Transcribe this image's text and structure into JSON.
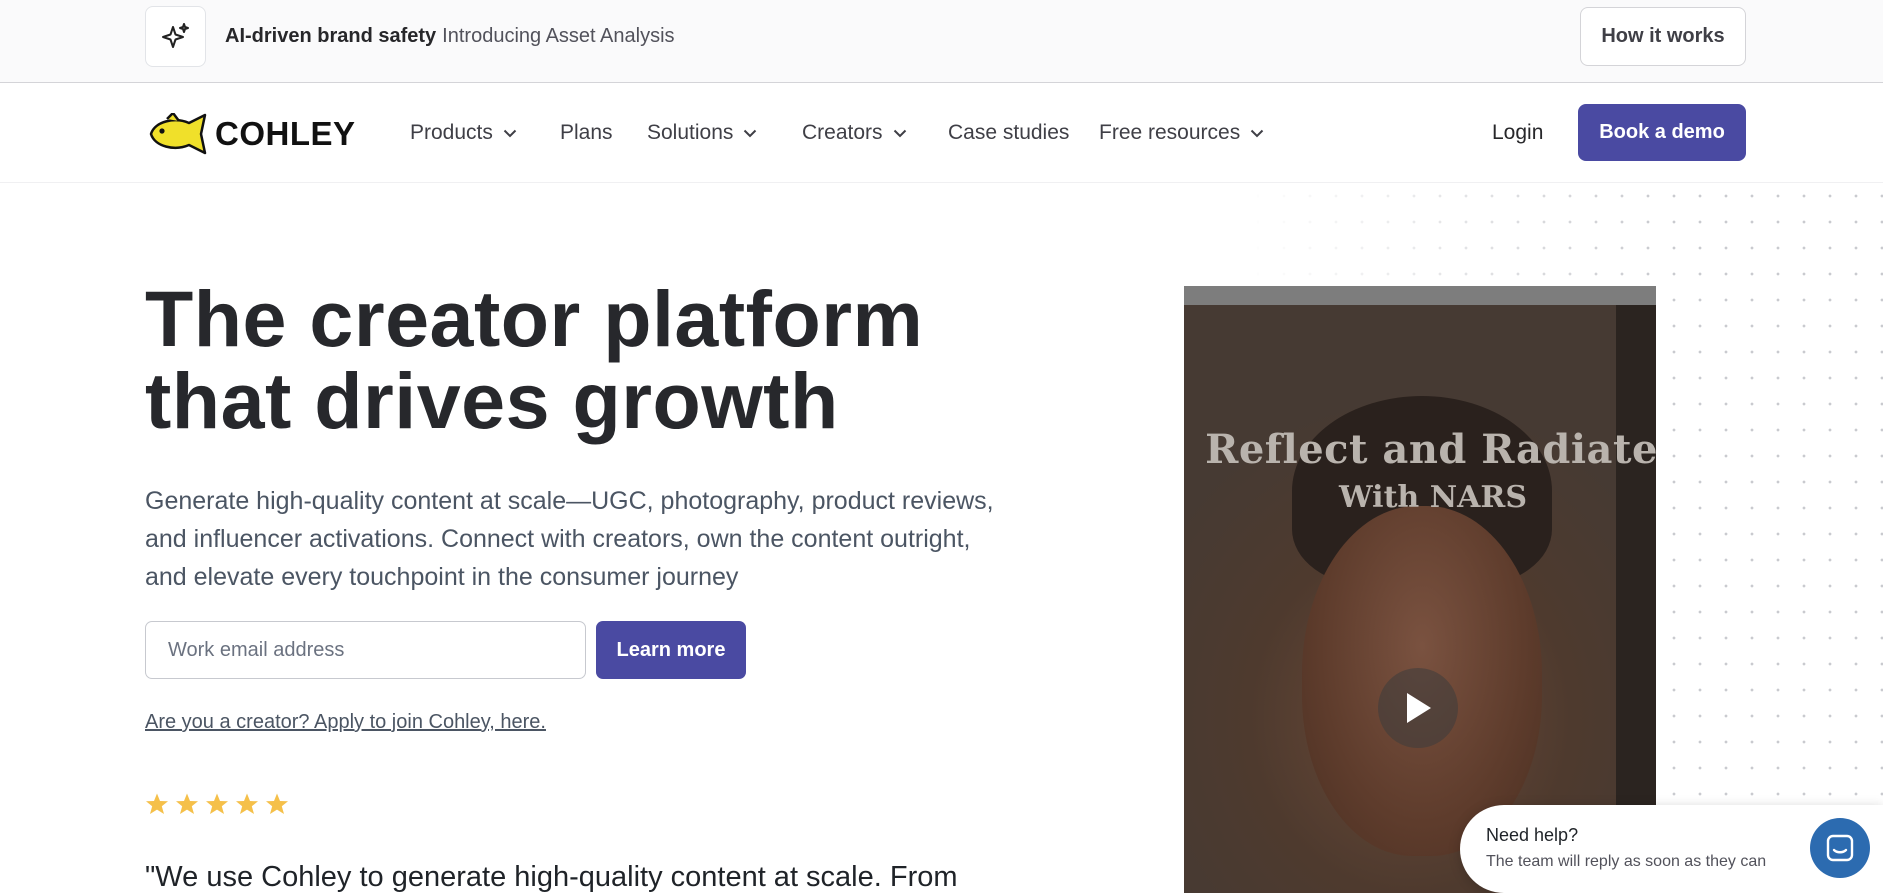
{
  "announcement": {
    "bold_text": "AI-driven brand safety",
    "text": "Introducing Asset Analysis",
    "button_label": "How it works",
    "icon": "sparkles-icon"
  },
  "nav": {
    "logo_text": "COHLEY",
    "items": [
      {
        "label": "Products",
        "dropdown": true
      },
      {
        "label": "Plans",
        "dropdown": false
      },
      {
        "label": "Solutions",
        "dropdown": true
      },
      {
        "label": "Creators",
        "dropdown": true
      },
      {
        "label": "Case studies",
        "dropdown": false
      },
      {
        "label": "Free resources",
        "dropdown": true
      }
    ],
    "login_label": "Login",
    "demo_label": "Book a demo"
  },
  "hero": {
    "headline": "The creator platform that drives growth",
    "subtext": "Generate high-quality content at scale—UGC, photography, product reviews, and influencer activations. Connect with creators, own the content outright, and elevate every touchpoint in the consumer journey",
    "email_placeholder": "Work email address",
    "cta_label": "Learn more",
    "creator_link": "Are you a creator? Apply to join Cohley, here.",
    "rating": 5,
    "quote": "\"We use Cohley to generate high-quality content at scale. From"
  },
  "video": {
    "title_line1": "Reflect and Radiate",
    "title_line2": "With NARS"
  },
  "help_widget": {
    "title": "Need help?",
    "subtitle": "The team will reply as soon as they can"
  },
  "colors": {
    "primary": "#4a4aa2",
    "star": "#f5c04a",
    "logo_fish": "#f0e02a",
    "chat": "#2c6bb0"
  }
}
